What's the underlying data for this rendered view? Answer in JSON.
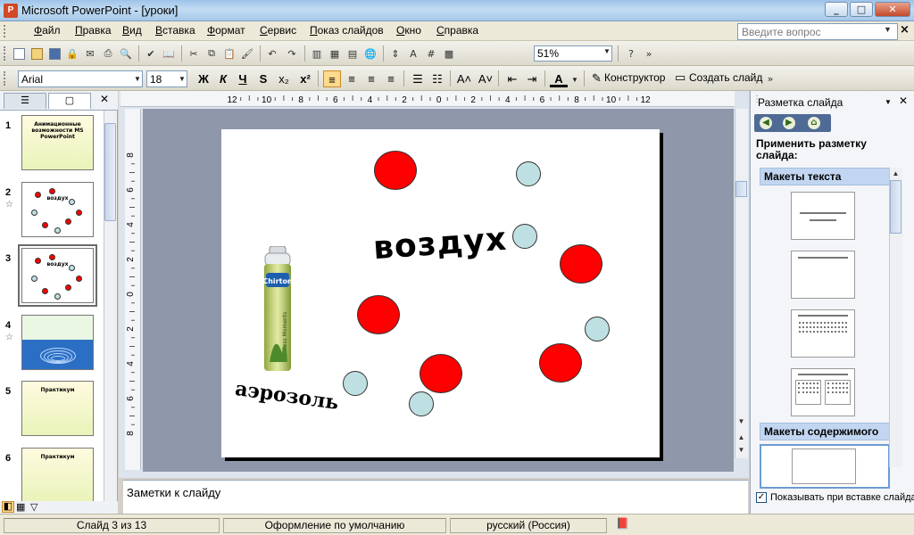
{
  "window": {
    "title": "Microsoft PowerPoint - [уроки]",
    "app_icon": "powerpoint-icon",
    "minimize": "_",
    "maximize": "□",
    "close": "✕"
  },
  "menu": {
    "items": [
      "Файл",
      "Правка",
      "Вид",
      "Вставка",
      "Формат",
      "Сервис",
      "Показ слайдов",
      "Окно",
      "Справка"
    ],
    "help_placeholder": "Введите вопрос",
    "doc_close": "×"
  },
  "toolbar_standard": {
    "zoom": "51%"
  },
  "toolbar_format": {
    "font": "Arial",
    "size": "18",
    "bold": "Ж",
    "italic": "К",
    "underline": "Ч",
    "shadow": "S",
    "superscript": "x²",
    "design_label": "Конструктор",
    "new_slide_label": "Создать слайд"
  },
  "slides_pane": {
    "thumbnails": [
      {
        "num": "1",
        "star": "",
        "title": "Анимационные возможности MS PowerPoint"
      },
      {
        "num": "2",
        "star": "☆",
        "title": "воздух"
      },
      {
        "num": "3",
        "star": "",
        "title": "воздух"
      },
      {
        "num": "4",
        "star": "☆",
        "title": ""
      },
      {
        "num": "5",
        "star": "",
        "title": "Практикум"
      },
      {
        "num": "6",
        "star": "",
        "title": "Практикум"
      }
    ],
    "selected": 3
  },
  "slide": {
    "word_air": "воздух",
    "word_aerosol": "аэрозоль",
    "can_label": "Chirton",
    "can_sublabel": "Endless Moments"
  },
  "notes": {
    "placeholder": "Заметки к слайду"
  },
  "task_pane": {
    "title": "Разметка слайда",
    "heading": "Применить разметку слайда:",
    "section_text": "Макеты текста",
    "section_content": "Макеты содержимого",
    "show_on_insert": "Показывать при вставке слайда",
    "show_checked": true
  },
  "ruler": {
    "h_ticks": [
      "12",
      "10",
      "8",
      "6",
      "4",
      "2",
      "0",
      "2",
      "4",
      "6",
      "8",
      "10",
      "12"
    ],
    "v_ticks": [
      "8",
      "6",
      "4",
      "2",
      "0",
      "2",
      "4",
      "6",
      "8"
    ]
  },
  "status": {
    "slide": "Слайд 3 из 13",
    "design": "Оформление по умолчанию",
    "language": "русский (Россия)"
  },
  "colors": {
    "accent_red": "#ff0000",
    "light_blue": "#bfe0e2",
    "canvas": "#8f97ab"
  }
}
